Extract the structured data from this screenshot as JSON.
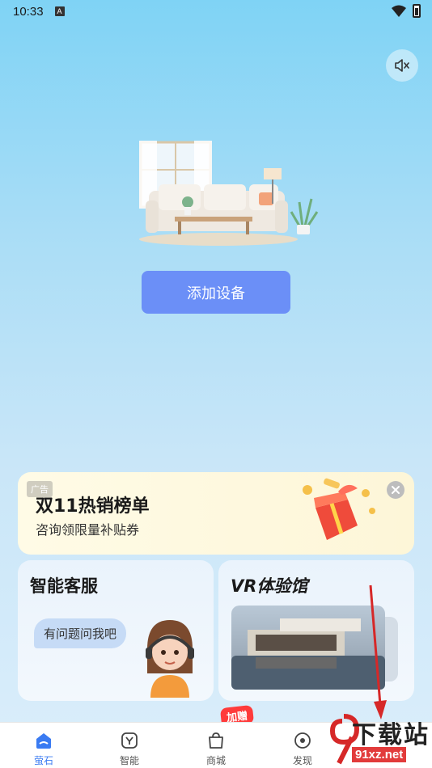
{
  "status_bar": {
    "time": "10:33",
    "notification_letter": "A"
  },
  "main": {
    "add_device_label": "添加设备"
  },
  "ad_banner": {
    "tag": "广告",
    "title": "双11热销榜单",
    "subtitle": "咨询领限量补贴券"
  },
  "cards": {
    "service": {
      "title": "智能客服",
      "bubble": "有问题问我吧"
    },
    "vr": {
      "title": "VR体验馆"
    }
  },
  "bottom_nav": {
    "items": [
      {
        "label": "萤石",
        "icon": "home-icon",
        "active": true
      },
      {
        "label": "智能",
        "icon": "smart-icon",
        "active": false
      },
      {
        "label": "商城",
        "icon": "shop-bag-icon",
        "active": false
      },
      {
        "label": "发现",
        "icon": "discover-icon",
        "active": false
      }
    ],
    "promo_badge": "加赠"
  },
  "watermark": {
    "title": "下载站",
    "url": "91xz.net"
  },
  "colors": {
    "accent": "#6b8ff7",
    "nav_active": "#3a7bf2",
    "promo": "#ff3b3b",
    "arrow": "#d62828"
  }
}
